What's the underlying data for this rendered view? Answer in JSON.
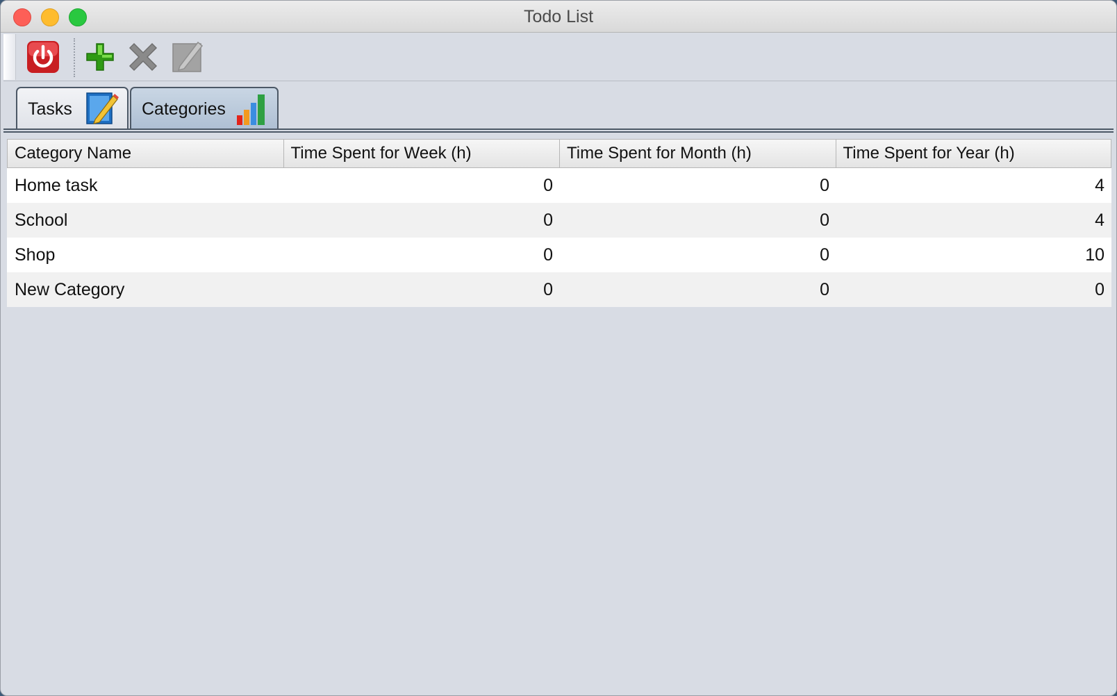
{
  "window": {
    "title": "Todo List"
  },
  "toolbar": {
    "buttons": [
      {
        "name": "power",
        "icon": "power-icon",
        "color": "#d9262b"
      },
      {
        "name": "add",
        "icon": "plus-icon",
        "color": "#3cb01f"
      },
      {
        "name": "delete",
        "icon": "x-icon",
        "color": "#8a8a8a"
      },
      {
        "name": "edit",
        "icon": "edit-icon",
        "color": "#9a9a9a"
      }
    ]
  },
  "tabs": [
    {
      "label": "Tasks",
      "icon": "notepad-pencil-icon",
      "active": false
    },
    {
      "label": "Categories",
      "icon": "bar-chart-icon",
      "active": true
    }
  ],
  "table": {
    "columns": [
      "Category Name",
      "Time Spent for Week (h)",
      "Time Spent for Month (h)",
      "Time Spent for Year (h)"
    ],
    "rows": [
      {
        "name": "Home task",
        "week": "0",
        "month": "0",
        "year": "4"
      },
      {
        "name": "School",
        "week": "0",
        "month": "0",
        "year": "4"
      },
      {
        "name": "Shop",
        "week": "0",
        "month": "0",
        "year": "10"
      },
      {
        "name": "New Category",
        "week": "0",
        "month": "0",
        "year": "0"
      }
    ]
  }
}
